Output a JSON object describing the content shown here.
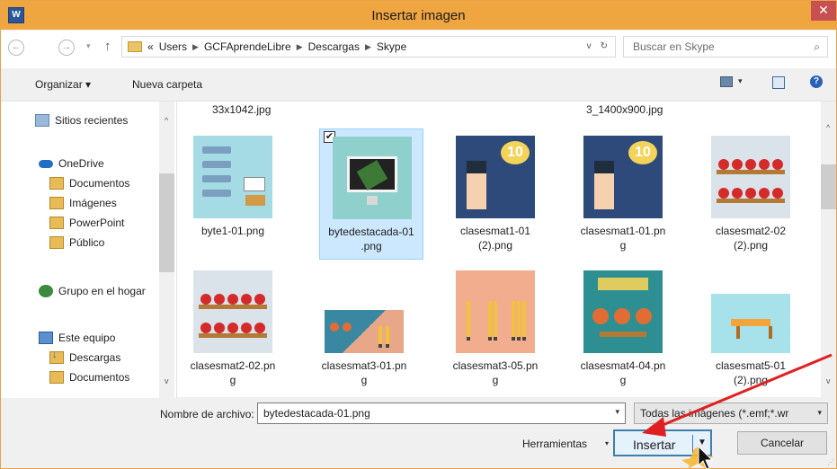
{
  "window": {
    "app_icon": "W",
    "title": "Insertar imagen",
    "close_glyph": "✕"
  },
  "navigation": {
    "back_glyph": "←",
    "forward_glyph": "→",
    "recent_dropdown_glyph": "▾",
    "up_glyph": "↑",
    "breadcrumbs": [
      "«",
      "Users",
      "GCFAprendeLibre",
      "Descargas",
      "Skype"
    ],
    "refresh_glyph": "↻",
    "history_glyph": "v",
    "search_placeholder": "Buscar en Skype",
    "search_icon_glyph": "⌕"
  },
  "toolbar": {
    "organize_label": "Organizar ▾",
    "new_folder_label": "Nueva carpeta",
    "view_caret": "▾",
    "help_glyph": "?"
  },
  "sidebar": {
    "scroll_up": "^",
    "scroll_down": "v",
    "items": [
      {
        "label": "Sitios recientes",
        "icon": "recent-places-icon"
      },
      {
        "label": "OneDrive",
        "icon": "onedrive-icon"
      },
      {
        "label": "Documentos",
        "icon": "folder-icon"
      },
      {
        "label": "Imágenes",
        "icon": "folder-icon"
      },
      {
        "label": "PowerPoint",
        "icon": "folder-icon"
      },
      {
        "label": "Público",
        "icon": "folder-icon"
      },
      {
        "label": "Grupo en el hogar",
        "icon": "homegroup-icon"
      },
      {
        "label": "Este equipo",
        "icon": "computer-icon"
      },
      {
        "label": "Descargas",
        "icon": "downloads-icon"
      },
      {
        "label": "Documentos",
        "icon": "folder-icon"
      }
    ]
  },
  "files": {
    "partial_top_left": "33x1042.jpg",
    "partial_top_right": "3_1400x900.jpg",
    "scroll_up": "^",
    "scroll_down": "v",
    "selected_check": "✔",
    "tiles": [
      {
        "name": "byte1-01.png"
      },
      {
        "name": "bytedestacada-01.png",
        "selected": true
      },
      {
        "name": "clasesmat1-01 (2).png",
        "badge": "10"
      },
      {
        "name": "clasesmat1-01.png",
        "badge": "10"
      },
      {
        "name": "clasesmat2-02 (2).png"
      },
      {
        "name": "clasesmat2-02.png"
      },
      {
        "name": "clasesmat3-01.png"
      },
      {
        "name": "clasesmat3-05.png"
      },
      {
        "name": "clasesmat4-04.png"
      },
      {
        "name": "clasesmat5-01 (2).png"
      }
    ],
    "captions": {
      "byte1": "byte1-01.png",
      "bytedest_l1": "bytedestacada-01",
      "bytedest_l2": ".png",
      "cm1a_l1": "clasesmat1-01",
      "cm1a_l2": "(2).png",
      "cm1b_l1": "clasesmat1-01.pn",
      "cm1b_l2": "g",
      "cm2a_l1": "clasesmat2-02",
      "cm2a_l2": "(2).png",
      "cm2b_l1": "clasesmat2-02.pn",
      "cm2b_l2": "g",
      "cm3a_l1": "clasesmat3-01.pn",
      "cm3a_l2": "g",
      "cm3b_l1": "clasesmat3-05.pn",
      "cm3b_l2": "g",
      "cm4_l1": "clasesmat4-04.pn",
      "cm4_l2": "g",
      "cm5_l1": "clasesmat5-01",
      "cm5_l2": "(2).png"
    }
  },
  "footer": {
    "filename_label": "Nombre de archivo:",
    "filename_value": "bytedestacada-01.png",
    "filename_caret": "▾",
    "filter_value": "Todas las imágenes (*.emf;*.wr",
    "filter_caret": "▾",
    "tools_label": "Herramientas",
    "tools_caret": "▾",
    "insert_label": "Insertar",
    "insert_caret": "▼",
    "cancel_label": "Cancelar"
  },
  "colors": {
    "titlebar": "#f0a640",
    "close": "#c75050",
    "selection": "#cce8ff",
    "annotation_arrow": "#e02020"
  }
}
